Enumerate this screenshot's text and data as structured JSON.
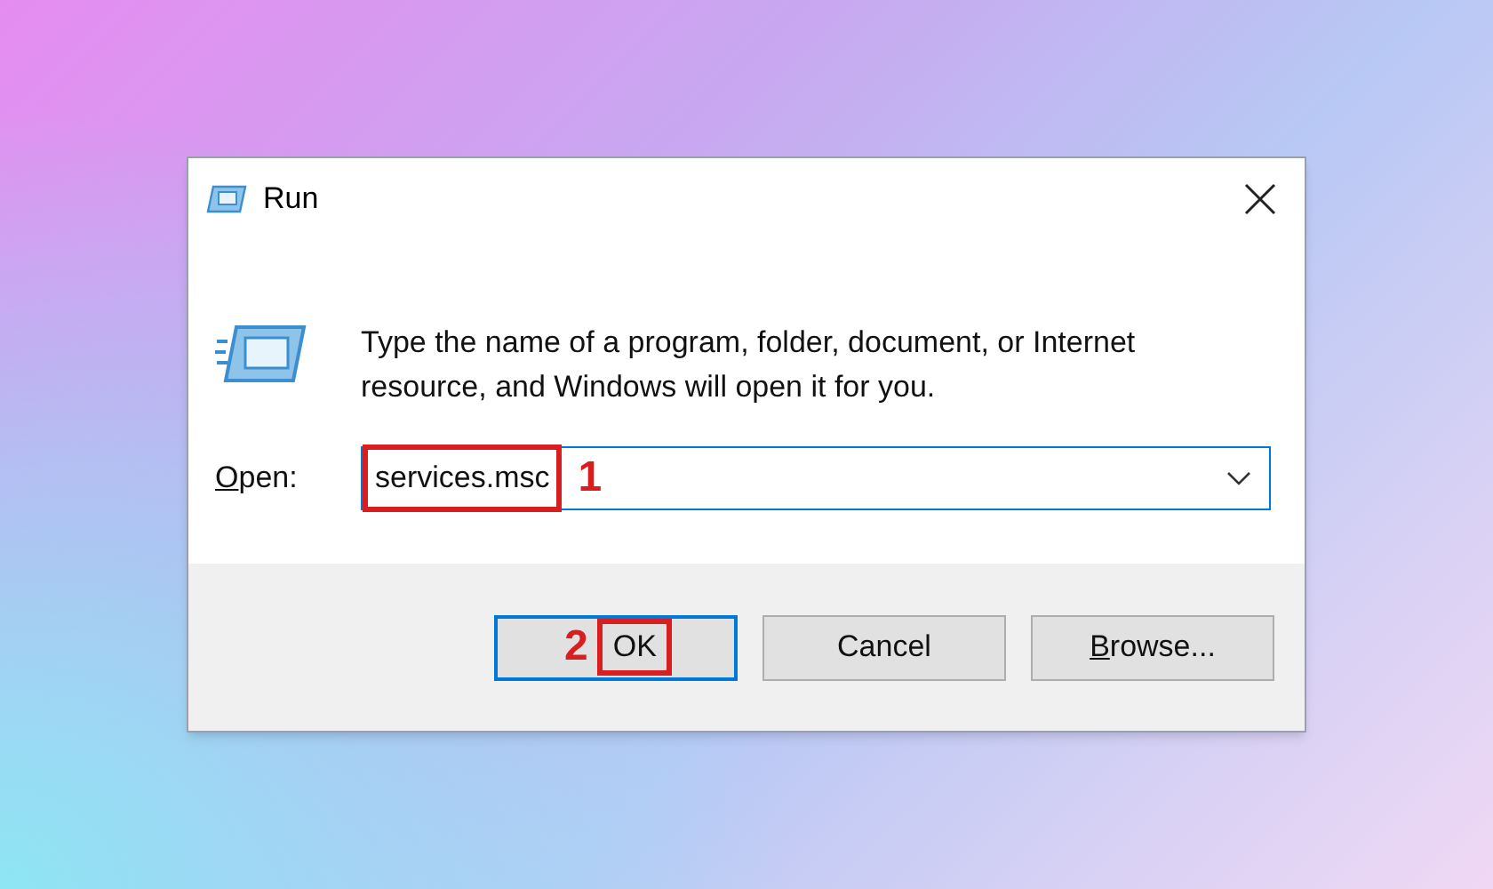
{
  "window": {
    "title": "Run"
  },
  "message": "Type the name of a program, folder, document, or Internet resource, and Windows will open it for you.",
  "open_field": {
    "label": {
      "access_key": "O",
      "rest": "pen:"
    },
    "value": "services.msc",
    "highlighted": true,
    "marker": "1"
  },
  "buttons": [
    {
      "rest": "OK",
      "default": true,
      "highlighted": true,
      "marker": "2"
    },
    {
      "rest": "Cancel",
      "default": false,
      "highlighted": false
    },
    {
      "access_key": "B",
      "rest": "rowse...",
      "default": false,
      "highlighted": false
    }
  ]
}
